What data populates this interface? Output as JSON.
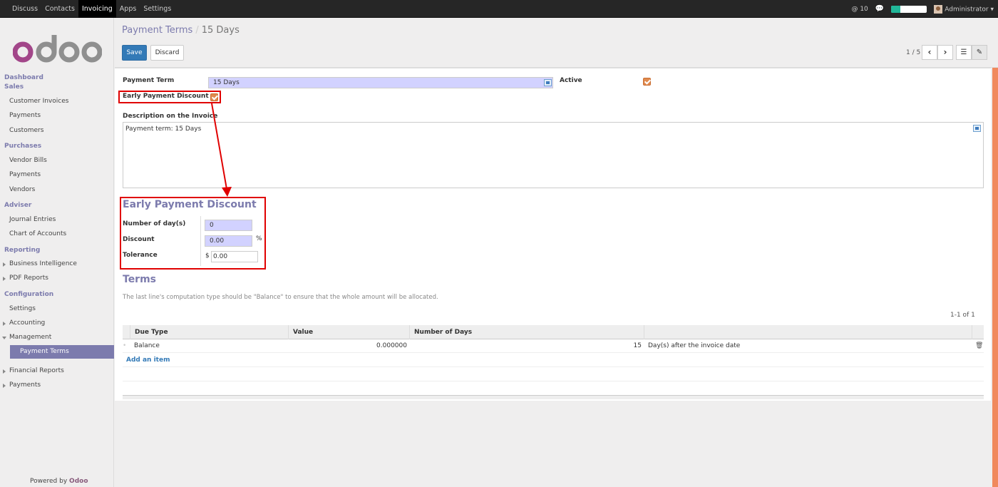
{
  "topbar": {
    "menu": [
      "Discuss",
      "Contacts",
      "Invoicing",
      "Apps",
      "Settings"
    ],
    "active_menu": "Invoicing",
    "notification_count": "10",
    "user": "Administrator",
    "progress": 0.25,
    "icons": [
      "at-icon",
      "chat-icon",
      "progress-bar",
      "avatar-icon",
      "caret-down-icon"
    ]
  },
  "sidebar": {
    "logo_text": "odoo",
    "sections": [
      {
        "title": "Dashboard"
      },
      {
        "title": "Sales",
        "items": [
          "Customer Invoices",
          "Payments",
          "Customers"
        ]
      },
      {
        "title": "Purchases",
        "items": [
          "Vendor Bills",
          "Payments",
          "Vendors"
        ]
      },
      {
        "title": "Adviser",
        "items": [
          "Journal Entries",
          "Chart of Accounts"
        ]
      },
      {
        "title": "Reporting",
        "items": [
          "Business Intelligence",
          "PDF Reports"
        ]
      },
      {
        "title": "Configuration",
        "items": [
          "Settings",
          "Accounting",
          "Management",
          "Payment Terms",
          "Financial Reports",
          "Payments"
        ]
      }
    ],
    "selected": "Payment Terms",
    "powered_by": "Powered by",
    "brand": "Odoo"
  },
  "control_panel": {
    "breadcrumb_parent": "Payment Terms",
    "breadcrumb_current": "15 Days",
    "save_label": "Save",
    "discard_label": "Discard",
    "pager": "1 / 5"
  },
  "form": {
    "payment_term_label": "Payment Term",
    "payment_term_value": "15 Days",
    "active_label": "Active",
    "active_checked": true,
    "early_discount_label": "Early Payment Discount",
    "early_discount_checked": true,
    "description_label": "Description on the Invoice",
    "description_value": "Payment term: 15 Days",
    "epd_section_title": "Early Payment Discount",
    "days_label": "Number of day(s)",
    "days_value": "0",
    "discount_label": "Discount",
    "discount_value": "0.00",
    "discount_unit": "%",
    "tolerance_label": "Tolerance",
    "tolerance_currency": "$",
    "tolerance_value": "0.00",
    "terms_title": "Terms",
    "terms_note": "The last line's computation type should be \"Balance\" to ensure that the whole amount will be allocated.",
    "list_pager": "1-1 of 1",
    "columns": [
      "Due Type",
      "Value",
      "Number of Days"
    ],
    "rows": [
      {
        "due_type": "Balance",
        "value": "0.000000",
        "days": "15",
        "days_desc": "Day(s) after the invoice date"
      }
    ],
    "add_item_label": "Add an item"
  },
  "annotation": {
    "color": "#e00000"
  }
}
